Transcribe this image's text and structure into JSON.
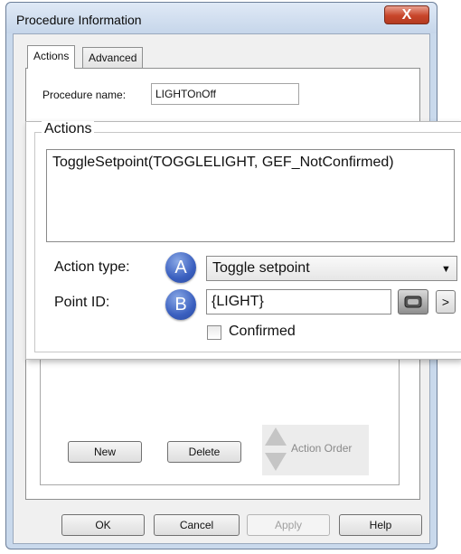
{
  "window": {
    "title": "Procedure Information",
    "close_label": "X"
  },
  "tabs": [
    {
      "label": "Actions",
      "selected": true
    },
    {
      "label": "Advanced",
      "selected": false
    }
  ],
  "procedure_name": {
    "label": "Procedure name:",
    "value": "LIGHTOnOff"
  },
  "actions_group": {
    "title": "Actions",
    "text": "ToggleSetpoint(TOGGLELIGHT, GEF_NotConfirmed)",
    "action_type": {
      "badge": "A",
      "label": "Action type:",
      "selected_value": "Toggle setpoint",
      "arrow": "▼"
    },
    "point_id": {
      "badge": "B",
      "label": "Point ID:",
      "value": "{LIGHT}",
      "more_label": ">"
    },
    "confirmed": {
      "label": "Confirmed",
      "checked": false
    }
  },
  "list_buttons": {
    "new": "New",
    "delete": "Delete",
    "action_order": "Action Order"
  },
  "dialog_buttons": {
    "ok": "OK",
    "cancel": "Cancel",
    "apply": "Apply",
    "help": "Help"
  },
  "icons": {
    "browse": "point-browser-icon",
    "close": "close-icon",
    "order_up": "arrow-up-icon",
    "order_down": "arrow-down-icon"
  },
  "colors": {
    "badge": "#3a5fbf",
    "close_button": "#c8452a",
    "window_frame": "#c9d9ec"
  }
}
